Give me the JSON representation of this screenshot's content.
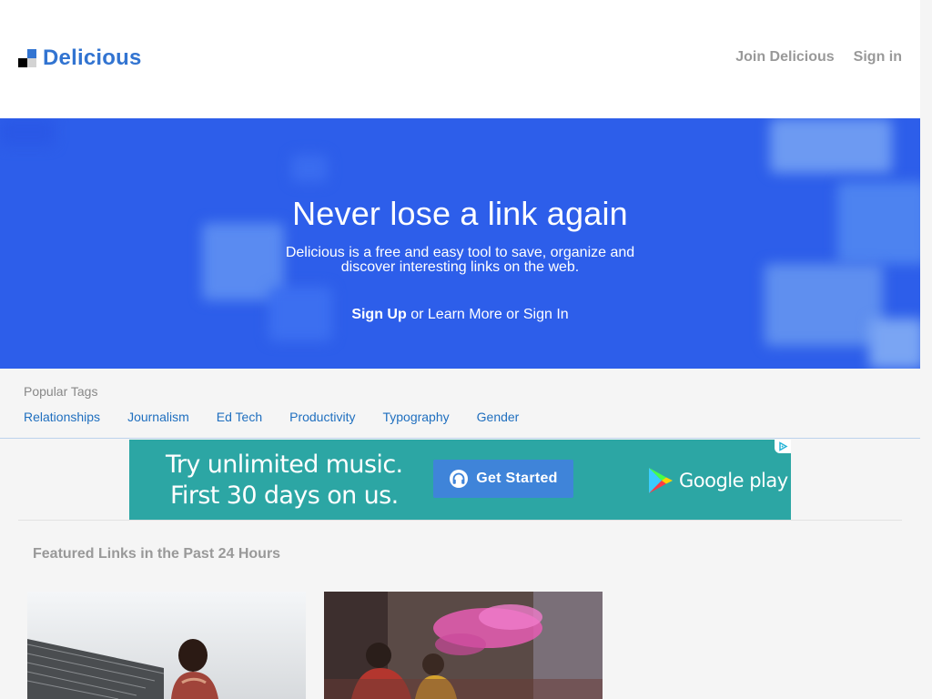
{
  "header": {
    "brand": "Delicious",
    "links": [
      {
        "label": "Join Delicious"
      },
      {
        "label": "Sign in"
      }
    ]
  },
  "hero": {
    "title": "Never lose a link again",
    "subtitle": "Delicious is a free and easy tool to save, organize and discover interesting links on the web.",
    "cta_primary": "Sign Up",
    "cta_sep1": "or",
    "cta_learn": "Learn More",
    "cta_sep2": "or",
    "cta_signin": "Sign In"
  },
  "tags": {
    "label": "Popular Tags",
    "items": [
      "Relationships",
      "Journalism",
      "Ed Tech",
      "Productivity",
      "Typography",
      "Gender"
    ]
  },
  "ad": {
    "line1": "Try unlimited music.",
    "line2": "First 30 days on us.",
    "button_label": "Get Started",
    "store_label": "Google play"
  },
  "featured": {
    "title": "Featured Links in the Past 24 Hours"
  },
  "colors": {
    "brand": "#3274d1",
    "hero_bg": "#2d5eea",
    "tag_link": "#1f6fbf",
    "ad_bg": "#2ca6a4",
    "ad_button": "#3f84d9"
  }
}
